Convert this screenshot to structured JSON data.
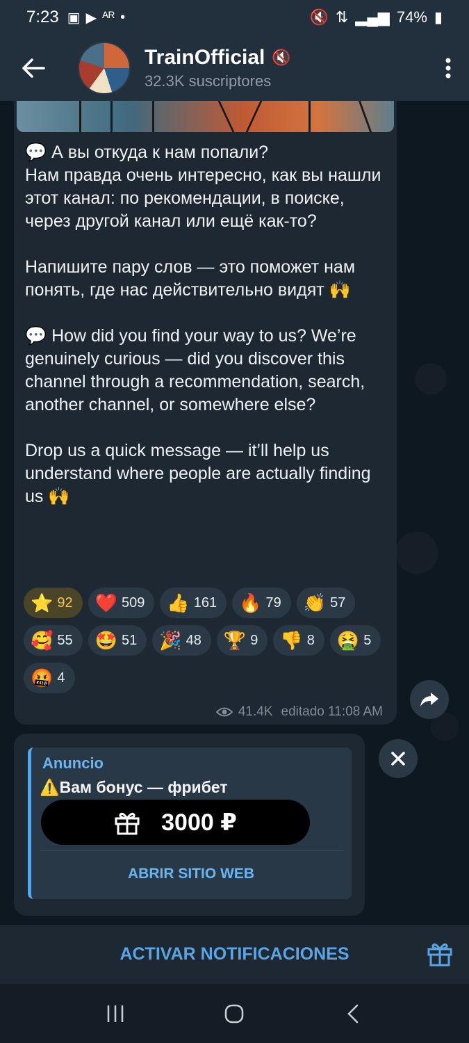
{
  "status_bar": {
    "time": "7:23",
    "battery": "74%",
    "left_icons": [
      "image-icon",
      "youtube-icon",
      "ar-icon",
      "dot-icon"
    ],
    "right_icons": [
      "mute-icon",
      "wifi-calling-icon",
      "signal-icon",
      "battery-icon"
    ]
  },
  "header": {
    "title": "TrainOfficial",
    "subtitle": "32.3K suscriptores"
  },
  "message": {
    "text": "💬 А вы откуда к нам попали?\nНам правда очень интересно, как вы нашли этот канал: по рекомендации, в поиске, через другой канал или ещё как-то?\n\nНапишите пару слов — это поможет нам понять, где нас действительно видят 🙌\n\n💬 How did you find your way to us? We’re genuinely curious — did you discover this channel through a recommendation, search, another channel, or somewhere else?\n\nDrop us a quick message — it’ll help us understand where people are actually finding us 🙌",
    "views": "41.4K",
    "meta": "editado 11:08 AM",
    "reactions": [
      {
        "emoji": "⭐",
        "count": "92",
        "type": "star"
      },
      {
        "emoji": "❤️",
        "count": "509"
      },
      {
        "emoji": "👍",
        "count": "161"
      },
      {
        "emoji": "🔥",
        "count": "79"
      },
      {
        "emoji": "👏",
        "count": "57"
      },
      {
        "emoji": "🥰",
        "count": "55"
      },
      {
        "emoji": "🤩",
        "count": "51"
      },
      {
        "emoji": "🎉",
        "count": "48"
      },
      {
        "emoji": "🏆",
        "count": "9"
      },
      {
        "emoji": "👎",
        "count": "8"
      },
      {
        "emoji": "🤮",
        "count": "5"
      },
      {
        "emoji": "🤬",
        "count": "4"
      }
    ]
  },
  "ad": {
    "label": "Anuncio",
    "title": "⚠️Вам бонус — фрибет",
    "amount": "3000 ₽",
    "open_button": "ABRIR SITIO WEB"
  },
  "bottom": {
    "notify_label": "ACTIVAR NOTIFICACIONES"
  },
  "colors": {
    "accent": "#5aa5e6",
    "bubble": "#1d2833",
    "header": "#22303d"
  }
}
